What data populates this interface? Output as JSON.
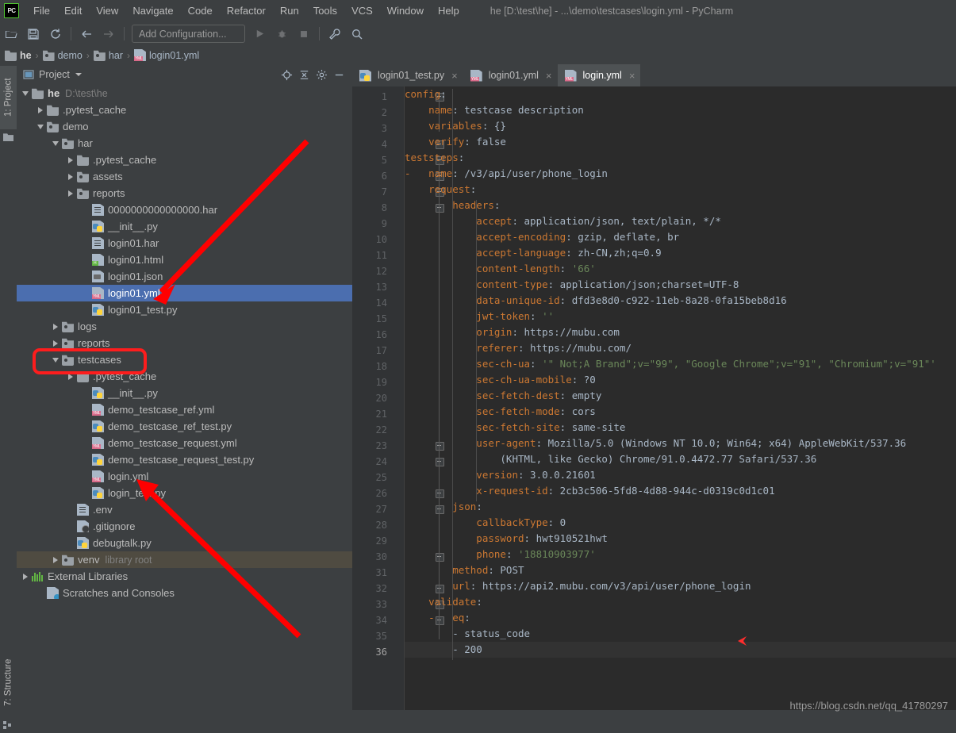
{
  "window": {
    "title": "he [D:\\test\\he] - ...\\demo\\testcases\\login.yml - PyCharm",
    "logo": "PC"
  },
  "menubar": {
    "items": [
      {
        "label": "File",
        "icon": "menu-file"
      },
      {
        "label": "Edit",
        "icon": "menu-edit"
      },
      {
        "label": "View",
        "icon": "menu-view"
      },
      {
        "label": "Navigate",
        "icon": "menu-navigate"
      },
      {
        "label": "Code",
        "icon": "menu-code"
      },
      {
        "label": "Refactor",
        "icon": "menu-refactor"
      },
      {
        "label": "Run",
        "icon": "menu-run"
      },
      {
        "label": "Tools",
        "icon": "menu-tools"
      },
      {
        "label": "VCS",
        "icon": "menu-vcs"
      },
      {
        "label": "Window",
        "icon": "menu-window"
      },
      {
        "label": "Help",
        "icon": "menu-help"
      }
    ]
  },
  "toolbar": {
    "open_icon": "open-folder-icon",
    "save_icon": "save-icon",
    "sync_icon": "sync-icon",
    "back_icon": "arrow-left-icon",
    "forward_icon": "arrow-right-icon",
    "config_label": "Add Configuration...",
    "run_icon": "run-play-icon",
    "debug_icon": "debug-bug-icon",
    "stop_icon": "stop-square-icon",
    "settings_icon": "wrench-icon",
    "search_icon": "search-icon"
  },
  "breadcrumb": {
    "items": [
      {
        "label": "he",
        "icon": "folder-icon",
        "bold": true
      },
      {
        "label": "demo",
        "icon": "module-folder-icon"
      },
      {
        "label": "har",
        "icon": "module-folder-icon"
      },
      {
        "label": "login01.yml",
        "icon": "yml-file-icon"
      }
    ],
    "separator": "›"
  },
  "stripes": {
    "project": "1: Project",
    "structure": "7: Structure"
  },
  "project_panel": {
    "title": "Project",
    "header_icons": [
      "locate-target-icon",
      "collapse-all-icon",
      "gear-icon",
      "minimize-icon"
    ],
    "tree": [
      {
        "label": "he",
        "sub": "D:\\test\\he",
        "icon": "folder-icon",
        "arrow": "open",
        "indent": 0,
        "bold": true
      },
      {
        "label": ".pytest_cache",
        "icon": "folder-icon",
        "arrow": "closed",
        "indent": 1
      },
      {
        "label": "demo",
        "icon": "module-folder-icon",
        "arrow": "open",
        "indent": 1
      },
      {
        "label": "har",
        "icon": "module-folder-icon",
        "arrow": "open",
        "indent": 2
      },
      {
        "label": ".pytest_cache",
        "icon": "folder-icon",
        "arrow": "closed",
        "indent": 3
      },
      {
        "label": "assets",
        "icon": "module-folder-icon",
        "arrow": "closed",
        "indent": 3
      },
      {
        "label": "reports",
        "icon": "module-folder-icon",
        "arrow": "closed",
        "indent": 3
      },
      {
        "label": "0000000000000000.har",
        "icon": "doc-file-icon",
        "arrow": "none",
        "indent": 4
      },
      {
        "label": "__init__.py",
        "icon": "python-file-icon",
        "arrow": "none",
        "indent": 4
      },
      {
        "label": "login01.har",
        "icon": "doc-file-icon",
        "arrow": "none",
        "indent": 4
      },
      {
        "label": "login01.html",
        "icon": "html-file-icon",
        "arrow": "none",
        "indent": 4
      },
      {
        "label": "login01.json",
        "icon": "json-file-icon",
        "arrow": "none",
        "indent": 4
      },
      {
        "label": "login01.yml",
        "icon": "yml-file-icon",
        "arrow": "none",
        "indent": 4,
        "selected": true
      },
      {
        "label": "login01_test.py",
        "icon": "python-file-icon",
        "arrow": "none",
        "indent": 4
      },
      {
        "label": "logs",
        "icon": "module-folder-icon",
        "arrow": "closed",
        "indent": 2
      },
      {
        "label": "reports",
        "icon": "module-folder-icon",
        "arrow": "closed",
        "indent": 2
      },
      {
        "label": "testcases",
        "icon": "module-folder-icon",
        "arrow": "open",
        "indent": 2,
        "highlight_box": true
      },
      {
        "label": ".pytest_cache",
        "icon": "folder-icon",
        "arrow": "closed",
        "indent": 3
      },
      {
        "label": "__init__.py",
        "icon": "python-file-icon",
        "arrow": "none",
        "indent": 4
      },
      {
        "label": "demo_testcase_ref.yml",
        "icon": "yml-file-icon",
        "arrow": "none",
        "indent": 4
      },
      {
        "label": "demo_testcase_ref_test.py",
        "icon": "python-file-icon",
        "arrow": "none",
        "indent": 4
      },
      {
        "label": "demo_testcase_request.yml",
        "icon": "yml-file-icon",
        "arrow": "none",
        "indent": 4
      },
      {
        "label": "demo_testcase_request_test.py",
        "icon": "python-file-icon",
        "arrow": "none",
        "indent": 4
      },
      {
        "label": "login.yml",
        "icon": "yml-file-icon",
        "arrow": "none",
        "indent": 4
      },
      {
        "label": "login_test.py",
        "icon": "python-file-icon",
        "arrow": "none",
        "indent": 4
      },
      {
        "label": ".env",
        "icon": "doc-file-icon",
        "arrow": "none",
        "indent": 3
      },
      {
        "label": ".gitignore",
        "icon": "gitignore-file-icon",
        "arrow": "none",
        "indent": 3
      },
      {
        "label": "debugtalk.py",
        "icon": "python-file-icon",
        "arrow": "none",
        "indent": 3
      },
      {
        "label": "venv",
        "sub": "library root",
        "icon": "module-folder-icon",
        "arrow": "closed",
        "indent": 2,
        "venv": true
      },
      {
        "label": "External Libraries",
        "icon": "external-libraries-icon",
        "arrow": "closed",
        "indent": 0
      },
      {
        "label": "Scratches and Consoles",
        "icon": "scratches-icon",
        "arrow": "none",
        "indent": 1
      }
    ]
  },
  "editor": {
    "tabs": [
      {
        "label": "login01_test.py",
        "icon": "python-file-icon",
        "active": false,
        "close": "×"
      },
      {
        "label": "login01.yml",
        "icon": "yml-file-icon",
        "active": false,
        "close": "×"
      },
      {
        "label": "login.yml",
        "icon": "yml-file-icon",
        "active": true,
        "close": "×"
      }
    ],
    "current_line": 36,
    "lines": [
      {
        "n": 1,
        "fold": true,
        "segments": [
          {
            "t": "config",
            "c": "k"
          },
          {
            "t": ":",
            "c": "v"
          }
        ]
      },
      {
        "n": 2,
        "segments": [
          {
            "t": "    name",
            "c": "k"
          },
          {
            "t": ": testcase description",
            "c": "v"
          }
        ]
      },
      {
        "n": 3,
        "segments": [
          {
            "t": "    variables",
            "c": "k"
          },
          {
            "t": ": {}",
            "c": "v"
          }
        ]
      },
      {
        "n": 4,
        "fold": true,
        "segments": [
          {
            "t": "    verify",
            "c": "k"
          },
          {
            "t": ": false",
            "c": "v"
          }
        ]
      },
      {
        "n": 5,
        "fold": true,
        "segments": [
          {
            "t": "teststeps",
            "c": "k"
          },
          {
            "t": ":",
            "c": "v"
          }
        ]
      },
      {
        "n": 6,
        "fold": true,
        "segments": [
          {
            "t": "-   ",
            "c": "d"
          },
          {
            "t": "name",
            "c": "k"
          },
          {
            "t": ": /v3/api/user/phone_login",
            "c": "v"
          }
        ]
      },
      {
        "n": 7,
        "fold": true,
        "segments": [
          {
            "t": "    request",
            "c": "k"
          },
          {
            "t": ":",
            "c": "v"
          }
        ]
      },
      {
        "n": 8,
        "fold": true,
        "segments": [
          {
            "t": "        headers",
            "c": "k"
          },
          {
            "t": ":",
            "c": "v"
          }
        ]
      },
      {
        "n": 9,
        "segments": [
          {
            "t": "            accept",
            "c": "k"
          },
          {
            "t": ": application/json, text/plain, */*",
            "c": "v"
          }
        ]
      },
      {
        "n": 10,
        "segments": [
          {
            "t": "            accept-encoding",
            "c": "k"
          },
          {
            "t": ": gzip, deflate, br",
            "c": "v"
          }
        ]
      },
      {
        "n": 11,
        "segments": [
          {
            "t": "            accept-language",
            "c": "k"
          },
          {
            "t": ": zh-CN,zh;q=0.9",
            "c": "v"
          }
        ]
      },
      {
        "n": 12,
        "segments": [
          {
            "t": "            content-length",
            "c": "k"
          },
          {
            "t": ": ",
            "c": "v"
          },
          {
            "t": "'66'",
            "c": "s"
          }
        ]
      },
      {
        "n": 13,
        "segments": [
          {
            "t": "            content-type",
            "c": "k"
          },
          {
            "t": ": application/json;charset=UTF-8",
            "c": "v"
          }
        ]
      },
      {
        "n": 14,
        "segments": [
          {
            "t": "            data-unique-id",
            "c": "k"
          },
          {
            "t": ": dfd3e8d0-c922-11eb-8a28-0fa15beb8d16",
            "c": "v"
          }
        ]
      },
      {
        "n": 15,
        "segments": [
          {
            "t": "            jwt-token",
            "c": "k"
          },
          {
            "t": ": ",
            "c": "v"
          },
          {
            "t": "''",
            "c": "s"
          }
        ]
      },
      {
        "n": 16,
        "segments": [
          {
            "t": "            origin",
            "c": "k"
          },
          {
            "t": ": https://mubu.com",
            "c": "v"
          }
        ]
      },
      {
        "n": 17,
        "segments": [
          {
            "t": "            referer",
            "c": "k"
          },
          {
            "t": ": https://mubu.com/",
            "c": "v"
          }
        ]
      },
      {
        "n": 18,
        "segments": [
          {
            "t": "            sec-ch-ua",
            "c": "k"
          },
          {
            "t": ": ",
            "c": "v"
          },
          {
            "t": "'\" Not;A Brand\";v=\"99\", \"Google Chrome\";v=\"91\", \"Chromium\";v=\"91\"'",
            "c": "s"
          }
        ]
      },
      {
        "n": 19,
        "segments": [
          {
            "t": "            sec-ch-ua-mobile",
            "c": "k"
          },
          {
            "t": ": ?0",
            "c": "v"
          }
        ]
      },
      {
        "n": 20,
        "segments": [
          {
            "t": "            sec-fetch-dest",
            "c": "k"
          },
          {
            "t": ": empty",
            "c": "v"
          }
        ]
      },
      {
        "n": 21,
        "segments": [
          {
            "t": "            sec-fetch-mode",
            "c": "k"
          },
          {
            "t": ": cors",
            "c": "v"
          }
        ]
      },
      {
        "n": 22,
        "segments": [
          {
            "t": "            sec-fetch-site",
            "c": "k"
          },
          {
            "t": ": same-site",
            "c": "v"
          }
        ]
      },
      {
        "n": 23,
        "fold": true,
        "segments": [
          {
            "t": "            user-agent",
            "c": "k"
          },
          {
            "t": ": Mozilla/5.0 (Windows NT 10.0; Win64; x64) AppleWebKit/537.36",
            "c": "v"
          }
        ]
      },
      {
        "n": 24,
        "fold": true,
        "segments": [
          {
            "t": "                (KHTML, like Gecko) Chrome/91.0.4472.77 Safari/537.36",
            "c": "v"
          }
        ]
      },
      {
        "n": 25,
        "segments": [
          {
            "t": "            version",
            "c": "k"
          },
          {
            "t": ": 3.0.0.21601",
            "c": "v"
          }
        ]
      },
      {
        "n": 26,
        "fold": true,
        "segments": [
          {
            "t": "            x-request-id",
            "c": "k"
          },
          {
            "t": ": 2cb3c506-5fd8-4d88-944c-d0319c0d1c01",
            "c": "v"
          }
        ]
      },
      {
        "n": 27,
        "fold": true,
        "segments": [
          {
            "t": "        json",
            "c": "k"
          },
          {
            "t": ":",
            "c": "v"
          }
        ]
      },
      {
        "n": 28,
        "segments": [
          {
            "t": "            callbackType",
            "c": "k"
          },
          {
            "t": ": 0",
            "c": "v"
          }
        ]
      },
      {
        "n": 29,
        "segments": [
          {
            "t": "            password",
            "c": "k"
          },
          {
            "t": ": hwt910521hwt",
            "c": "v"
          }
        ]
      },
      {
        "n": 30,
        "fold": true,
        "segments": [
          {
            "t": "            phone",
            "c": "k"
          },
          {
            "t": ": ",
            "c": "v"
          },
          {
            "t": "'18810903977'",
            "c": "s"
          }
        ]
      },
      {
        "n": 31,
        "segments": [
          {
            "t": "        method",
            "c": "k"
          },
          {
            "t": ": POST",
            "c": "v"
          }
        ]
      },
      {
        "n": 32,
        "fold": true,
        "segments": [
          {
            "t": "        url",
            "c": "k"
          },
          {
            "t": ": https://api2.mubu.com/v3/api/user/phone_login",
            "c": "v"
          }
        ]
      },
      {
        "n": 33,
        "fold": true,
        "segments": [
          {
            "t": "    validate",
            "c": "k"
          },
          {
            "t": ":",
            "c": "v"
          }
        ]
      },
      {
        "n": 34,
        "fold": true,
        "segments": [
          {
            "t": "    -   ",
            "c": "d"
          },
          {
            "t": "eq",
            "c": "k"
          },
          {
            "t": ":",
            "c": "v"
          }
        ]
      },
      {
        "n": 35,
        "segments": [
          {
            "t": "        - status_code",
            "c": "v"
          }
        ]
      },
      {
        "n": 36,
        "fold": true,
        "segments": [
          {
            "t": "        - 200",
            "c": "v"
          }
        ]
      }
    ]
  },
  "annotations": {
    "arrow_color": "#ff0000",
    "box_color": "#fd1d1d",
    "marker_color": "#ff2d2d",
    "arrow1": {
      "label": "arrow-to-login01-yml"
    },
    "arrow2": {
      "label": "arrow-to-login-yml"
    },
    "box": {
      "label": "highlight-testcases-folder"
    },
    "caret": {
      "label": "editor-line-marker"
    }
  },
  "watermark": {
    "text": "https://blog.csdn.net/qq_41780297"
  }
}
